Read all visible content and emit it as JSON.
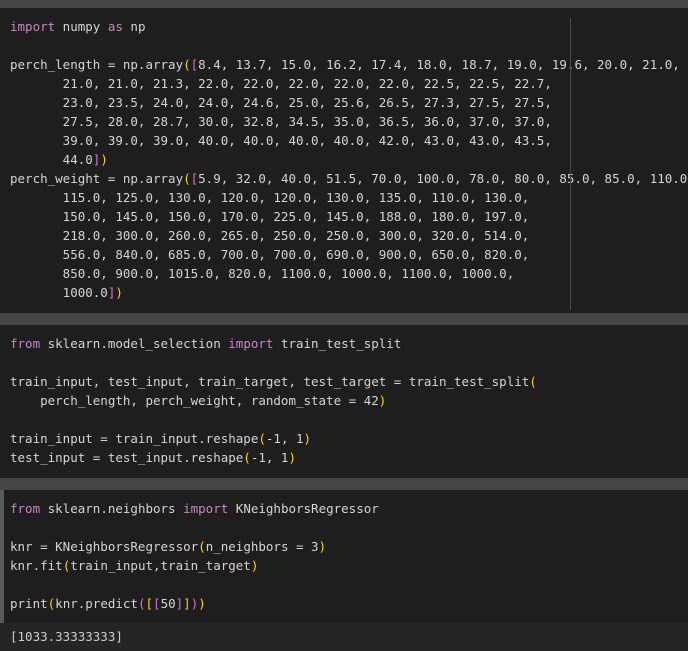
{
  "cell1": {
    "lines": [
      [
        "import",
        " numpy ",
        "as",
        " np"
      ],
      "",
      [
        "perch_length = np.array",
        "(",
        "[",
        "8.4, 13.7, 15.0, 16.2, 17.4, 18.0, 18.7, 19.0, 19.6, 20.0, 21.0,"
      ],
      "       21.0, 21.0, 21.3, 22.0, 22.0, 22.0, 22.0, 22.0, 22.5, 22.5, 22.7,",
      "       23.0, 23.5, 24.0, 24.0, 24.6, 25.0, 25.6, 26.5, 27.3, 27.5, 27.5,",
      "       27.5, 28.0, 28.7, 30.0, 32.8, 34.5, 35.0, 36.5, 36.0, 37.0, 37.0,",
      "       39.0, 39.0, 39.0, 40.0, 40.0, 40.0, 40.0, 42.0, 43.0, 43.0, 43.5,",
      [
        "       44.0",
        "]",
        ")"
      ],
      [
        "perch_weight = np.array",
        "(",
        "[",
        "5.9, 32.0, 40.0, 51.5, 70.0, 100.0, 78.0, 80.0, 85.0, 85.0, 110.0,"
      ],
      "       115.0, 125.0, 130.0, 120.0, 120.0, 130.0, 135.0, 110.0, 130.0,",
      "       150.0, 145.0, 150.0, 170.0, 225.0, 145.0, 188.0, 180.0, 197.0,",
      "       218.0, 300.0, 260.0, 265.0, 250.0, 250.0, 300.0, 320.0, 514.0,",
      "       556.0, 840.0, 685.0, 700.0, 700.0, 690.0, 900.0, 650.0, 820.0,",
      "       850.0, 900.0, 1015.0, 820.0, 1100.0, 1000.0, 1100.0, 1000.0,",
      [
        "       1000.0",
        "]",
        ")"
      ]
    ]
  },
  "cell2": {
    "line1": [
      "from",
      " sklearn.model_selection ",
      "import",
      " train_test_split"
    ],
    "line2": [
      "train_input, test_input, train_target, test_target = train_test_split",
      "("
    ],
    "line3": [
      "    perch_length, perch_weight, random_state = 42",
      ")"
    ],
    "line4": [
      "train_input = train_input.reshape",
      "(",
      "-1, 1",
      ")"
    ],
    "line5": [
      "test_input = test_input.reshape",
      "(",
      "-1, 1",
      ")"
    ]
  },
  "cell3": {
    "line1": [
      "from",
      " sklearn.neighbors ",
      "import",
      " KNeighborsRegressor"
    ],
    "line2": [
      "knr = KNeighborsRegressor",
      "(",
      "n_neighbors = 3",
      ")"
    ],
    "line3": [
      "knr.fit",
      "(",
      "train_input,train_target",
      ")"
    ],
    "line4": [
      "print",
      "(",
      "knr.predict",
      "(",
      "[",
      "[",
      "50",
      "]",
      "]",
      ")",
      ")"
    ]
  },
  "output": "[1033.33333333]"
}
